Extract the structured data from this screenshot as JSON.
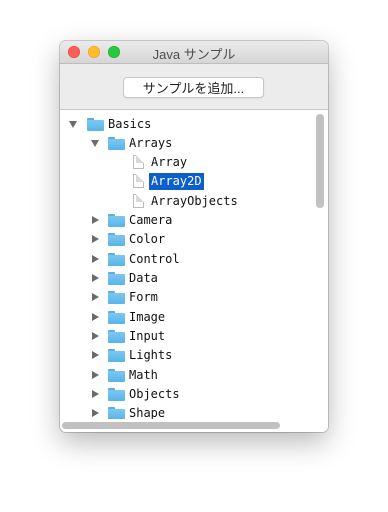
{
  "window": {
    "title": "Java サンプル"
  },
  "toolbar": {
    "add_button_label": "サンプルを追加..."
  },
  "tree": {
    "root": {
      "label": "Basics",
      "expanded": true
    },
    "arrays": {
      "label": "Arrays",
      "expanded": true
    },
    "files": [
      {
        "label": "Array",
        "selected": false
      },
      {
        "label": "Array2D",
        "selected": true
      },
      {
        "label": "ArrayObjects",
        "selected": false
      }
    ],
    "folders": [
      "Camera",
      "Color",
      "Control",
      "Data",
      "Form",
      "Image",
      "Input",
      "Lights",
      "Math",
      "Objects",
      "Shape"
    ]
  },
  "colors": {
    "selection": "#0c5ec8",
    "folder": "#6cbdef",
    "close": "#fc5f57",
    "minimize": "#fdbc2e",
    "zoom": "#29c83f"
  }
}
